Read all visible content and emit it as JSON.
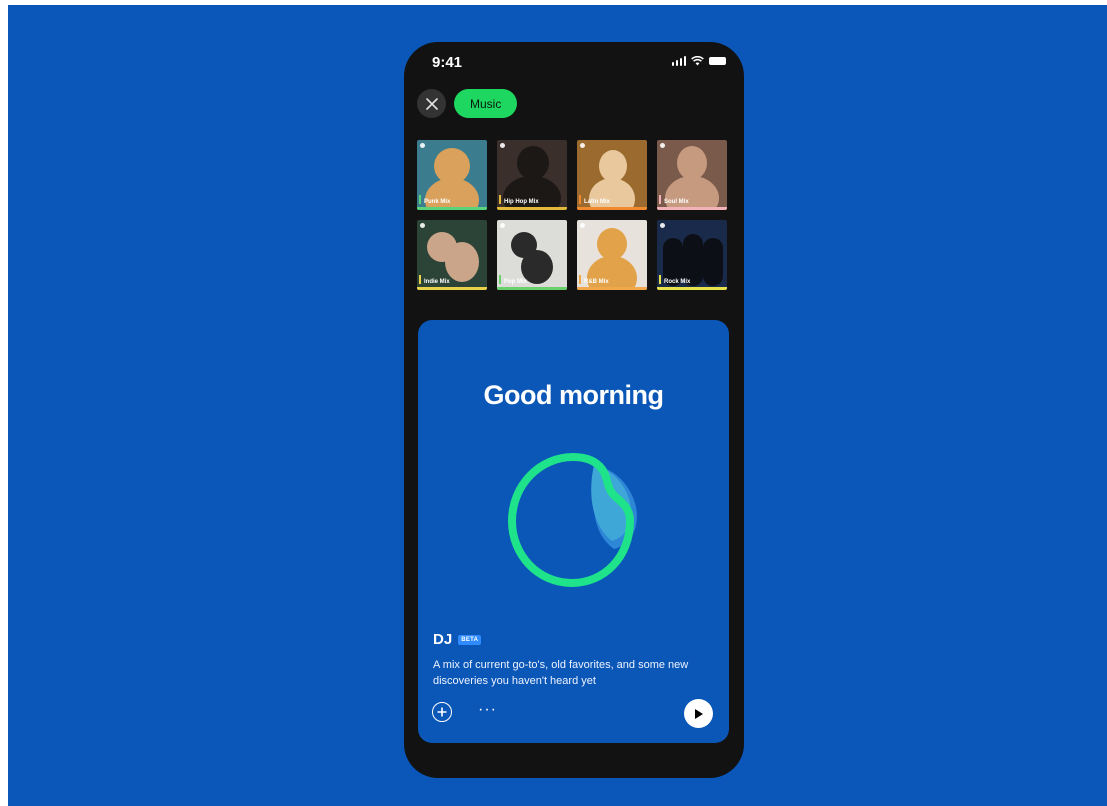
{
  "status_bar": {
    "time": "9:41"
  },
  "filters": {
    "active_chip": "Music"
  },
  "mixes": [
    {
      "label": "Punk Mix",
      "bar_color": "#5ad47a",
      "bg": "#3b7d8f",
      "fig": "#d9a15b"
    },
    {
      "label": "Hip Hop Mix",
      "bar_color": "#e2b93b",
      "bg": "#3a2f2a",
      "fig": "#1b1816"
    },
    {
      "label": "Latin Mix",
      "bar_color": "#f08a2e",
      "bg": "#9a6a2e",
      "fig": "#e8c89c"
    },
    {
      "label": "Soul Mix",
      "bar_color": "#f2b2b8",
      "bg": "#7a5a4a",
      "fig": "#c69a7f"
    },
    {
      "label": "Indie Mix",
      "bar_color": "#e9d24a",
      "bg": "#2c4438",
      "fig": "#caa58a"
    },
    {
      "label": "Pop Mix",
      "bar_color": "#6ad06c",
      "bg": "#dcdcd8",
      "fig": "#2a2a2a"
    },
    {
      "label": "R&B Mix",
      "bar_color": "#f0a84a",
      "bg": "#e8e2dc",
      "fig": "#e2a24a"
    },
    {
      "label": "Rock Mix",
      "bar_color": "#e8e24a",
      "bg": "#1a2a4a",
      "fig": "#0d0f17"
    }
  ],
  "dj_card": {
    "greeting": "Good morning",
    "title": "DJ",
    "badge": "BETA",
    "description": "A mix of current go-to's, old favorites, and some new discoveries you haven't heard yet",
    "more_label": "···"
  },
  "colors": {
    "background": "#0a57b9",
    "phone": "#121212",
    "accent_green": "#1ed760",
    "card_blue": "#0b57b8"
  },
  "icons": [
    "close-icon",
    "plus-circle-icon",
    "more-icon",
    "play-icon",
    "signal-icon",
    "wifi-icon",
    "battery-icon"
  ]
}
